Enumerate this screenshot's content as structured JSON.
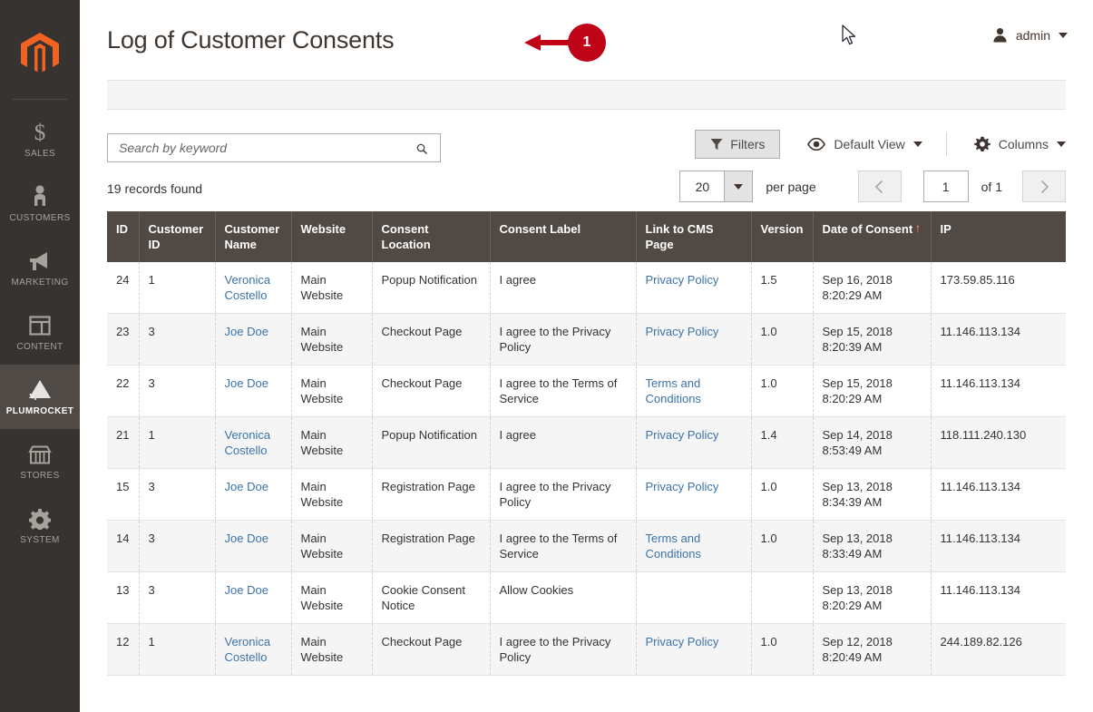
{
  "sidebar": {
    "logo_name": "magento-logo-icon",
    "items": [
      {
        "label": "SALES",
        "icon": "dollar-icon",
        "active": false
      },
      {
        "label": "CUSTOMERS",
        "icon": "person-icon",
        "active": false
      },
      {
        "label": "MARKETING",
        "icon": "megaphone-icon",
        "active": false
      },
      {
        "label": "CONTENT",
        "icon": "layout-icon",
        "active": false
      },
      {
        "label": "PLUMROCKET",
        "icon": "plumrocket-icon",
        "active": true
      },
      {
        "label": "STORES",
        "icon": "storefront-icon",
        "active": false
      },
      {
        "label": "SYSTEM",
        "icon": "gear-icon",
        "active": false
      }
    ]
  },
  "header": {
    "title": "Log of Customer Consents",
    "admin_user": "admin",
    "user_icon": "user-avatar-icon",
    "caret_icon": "chevron-down-icon"
  },
  "annotation": {
    "number": "1",
    "color": "#c00418",
    "arrow_icon": "left-arrow-icon"
  },
  "toolbar": {
    "search_placeholder": "Search by keyword",
    "search_value": "",
    "search_icon": "search-icon",
    "filters_label": "Filters",
    "filters_icon": "funnel-icon",
    "view_label": "Default View",
    "view_icon": "eye-icon",
    "columns_label": "Columns",
    "columns_icon": "gear-icon"
  },
  "grid_info": {
    "records_found": "19 records found",
    "per_page_value": "20",
    "per_page_label": "per page",
    "current_page": "1",
    "of_label": "of 1",
    "prev_icon": "chevron-left-icon",
    "next_icon": "chevron-right-icon"
  },
  "table": {
    "columns": [
      {
        "label": "ID",
        "sorted": false
      },
      {
        "label": "Customer ID",
        "sorted": false
      },
      {
        "label": "Customer Name",
        "sorted": false
      },
      {
        "label": "Website",
        "sorted": false
      },
      {
        "label": "Consent Location",
        "sorted": false
      },
      {
        "label": "Consent Label",
        "sorted": false
      },
      {
        "label": "Link to CMS Page",
        "sorted": false
      },
      {
        "label": "Version",
        "sorted": false
      },
      {
        "label": "Date of Consent",
        "sorted": true,
        "sort_dir": "↑"
      },
      {
        "label": "IP",
        "sorted": false
      }
    ],
    "rows": [
      {
        "id": "24",
        "customer_id": "1",
        "customer_name": "Veronica Costello",
        "website": "Main Website",
        "consent_location": "Popup Notification",
        "consent_label": "I agree",
        "cms_page": "Privacy Policy",
        "version": "1.5",
        "date_of_consent": "Sep 16, 2018 8:20:29 AM",
        "ip": "173.59.85.116"
      },
      {
        "id": "23",
        "customer_id": "3",
        "customer_name": "Joe Doe",
        "website": "Main Website",
        "consent_location": "Checkout Page",
        "consent_label": "I agree to the Privacy Policy",
        "cms_page": "Privacy Policy",
        "version": "1.0",
        "date_of_consent": "Sep 15, 2018 8:20:39 AM",
        "ip": "11.146.113.134"
      },
      {
        "id": "22",
        "customer_id": "3",
        "customer_name": "Joe Doe",
        "website": "Main Website",
        "consent_location": "Checkout Page",
        "consent_label": "I agree to the Terms of Service",
        "cms_page": "Terms and Conditions",
        "version": "1.0",
        "date_of_consent": "Sep 15, 2018 8:20:29 AM",
        "ip": "11.146.113.134"
      },
      {
        "id": "21",
        "customer_id": "1",
        "customer_name": "Veronica Costello",
        "website": "Main Website",
        "consent_location": "Popup Notification",
        "consent_label": "I agree",
        "cms_page": "Privacy Policy",
        "version": "1.4",
        "date_of_consent": "Sep 14, 2018 8:53:49 AM",
        "ip": "118.111.240.130"
      },
      {
        "id": "15",
        "customer_id": "3",
        "customer_name": "Joe Doe",
        "website": "Main Website",
        "consent_location": "Registration Page",
        "consent_label": "I agree to the Privacy Policy",
        "cms_page": "Privacy Policy",
        "version": "1.0",
        "date_of_consent": "Sep 13, 2018 8:34:39 AM",
        "ip": "11.146.113.134"
      },
      {
        "id": "14",
        "customer_id": "3",
        "customer_name": "Joe Doe",
        "website": "Main Website",
        "consent_location": "Registration Page",
        "consent_label": "I agree to the Terms of Service",
        "cms_page": "Terms and Conditions",
        "version": "1.0",
        "date_of_consent": "Sep 13, 2018 8:33:49 AM",
        "ip": "11.146.113.134"
      },
      {
        "id": "13",
        "customer_id": "3",
        "customer_name": "Joe Doe",
        "website": "Main Website",
        "consent_location": "Cookie Consent Notice",
        "consent_label": "Allow Cookies",
        "cms_page": "",
        "version": "",
        "date_of_consent": "Sep 13, 2018 8:20:29 AM",
        "ip": "11.146.113.134"
      },
      {
        "id": "12",
        "customer_id": "1",
        "customer_name": "Veronica Costello",
        "website": "Main Website",
        "consent_location": "Checkout Page",
        "consent_label": "I agree to the Privacy Policy",
        "cms_page": "Privacy Policy",
        "version": "1.0",
        "date_of_consent": "Sep 12, 2018 8:20:49 AM",
        "ip": "244.189.82.126"
      }
    ]
  }
}
